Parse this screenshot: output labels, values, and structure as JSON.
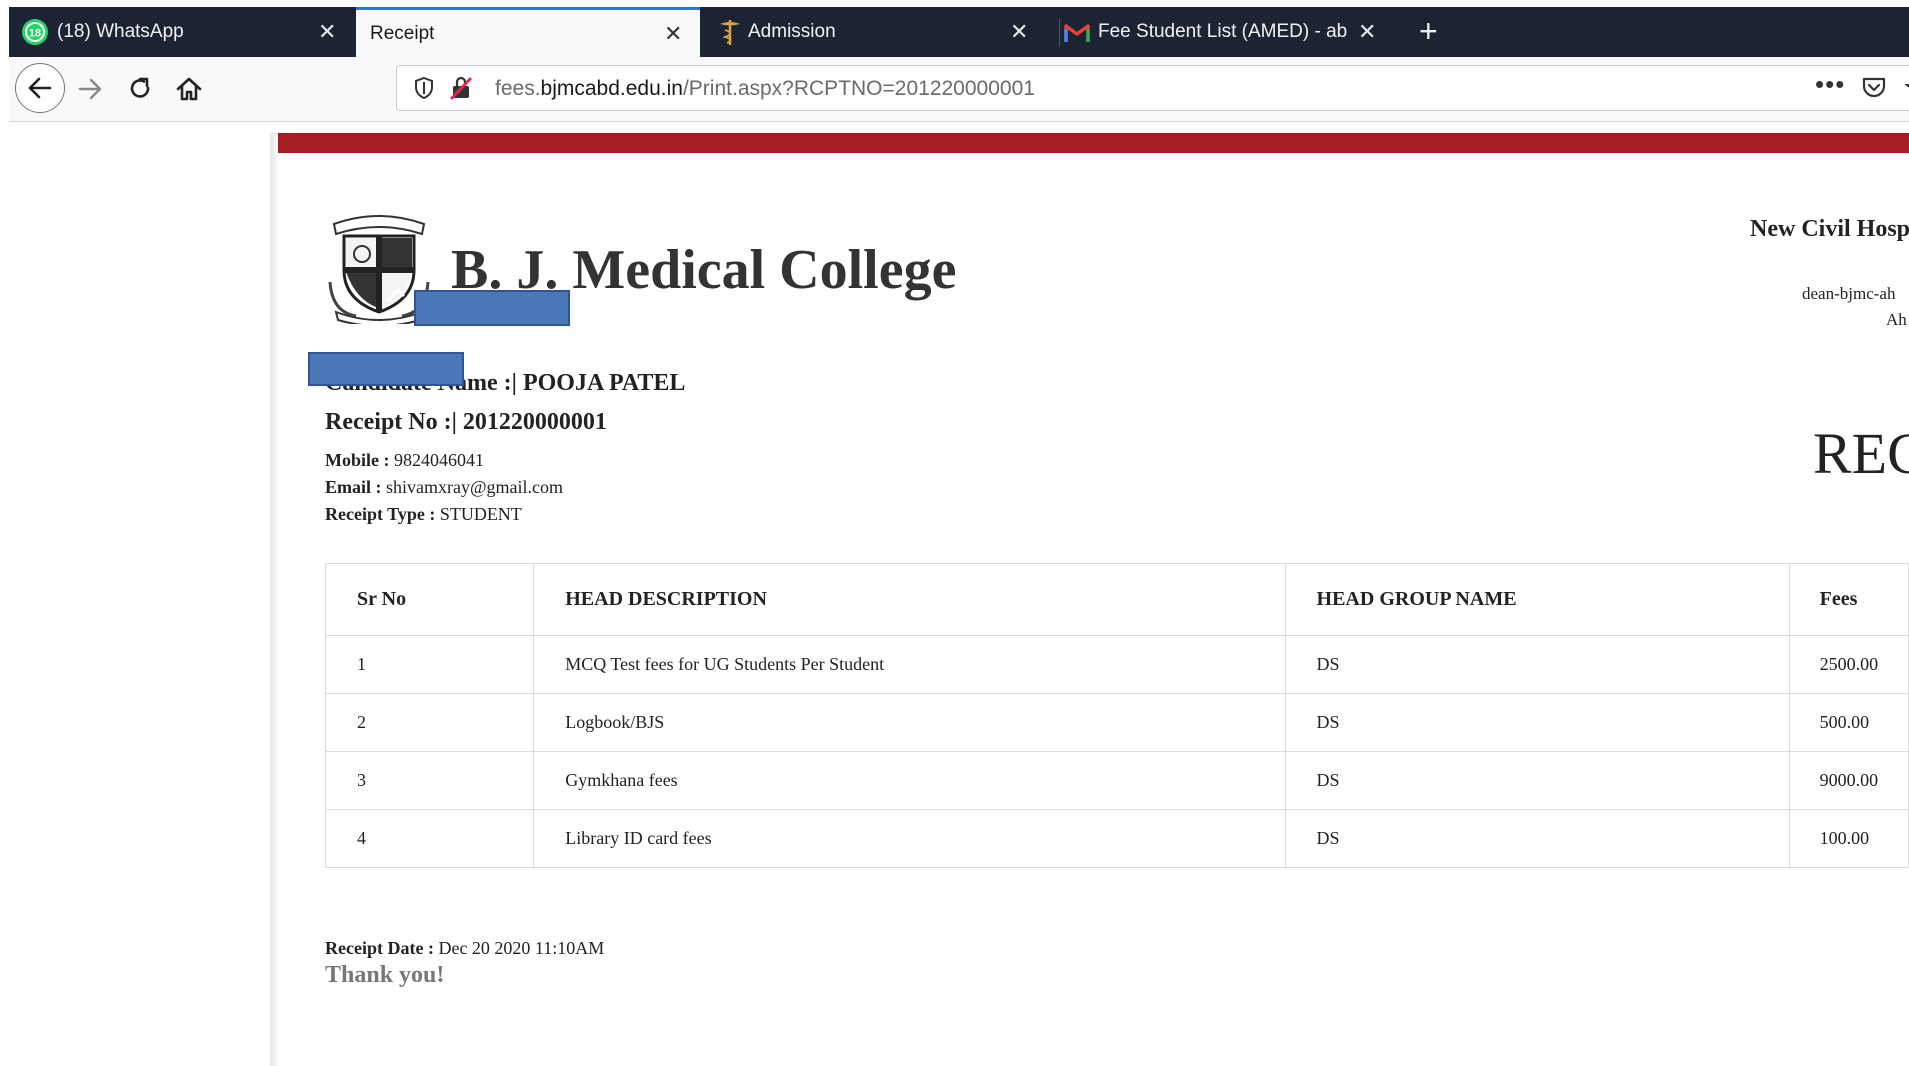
{
  "browser": {
    "tabs": [
      {
        "title": "(18) WhatsApp",
        "icon": "whatsapp-icon",
        "active": false
      },
      {
        "title": "Receipt",
        "icon": "",
        "active": true
      },
      {
        "title": "Admission",
        "icon": "caduceus-icon",
        "active": false
      },
      {
        "title": "Fee Student List (AMED) - abni",
        "icon": "gmail-icon",
        "active": false
      }
    ],
    "whatsapp_badge": "18",
    "url": {
      "prefix": "fees.",
      "domain": "bjmcabd.edu.in",
      "path": "/Print.aspx?RCPTNO=201220000001"
    },
    "colors": {
      "tabbar": "#1c2333",
      "active_tab_accent": "#2a77d4"
    }
  },
  "receipt": {
    "college_name": "B. J. Medical College",
    "hospital_partial": "New Civil Hosp",
    "dean_email_partial": "dean-bjmc-ah",
    "city_partial": "Ah",
    "heading_partial": "REC",
    "candidate_name_label": "Candidate Name :|",
    "candidate_name": "POOJA PATEL",
    "receipt_no_label": "Receipt No :|",
    "receipt_no": "201220000001",
    "mobile_label": "Mobile :",
    "mobile": "9824046041",
    "email_label": "Email :",
    "email": "shivamxray@gmail.com",
    "receipt_type_label": "Receipt Type :",
    "receipt_type": "STUDENT",
    "table": {
      "headers": [
        "Sr No",
        "HEAD DESCRIPTION",
        "HEAD GROUP NAME",
        "Fees"
      ],
      "rows": [
        [
          "1",
          "MCQ Test fees for UG Students Per Student",
          "DS",
          "2500.00"
        ],
        [
          "2",
          "Logbook/BJS",
          "DS",
          "500.00"
        ],
        [
          "3",
          "Gymkhana fees",
          "DS",
          "9000.00"
        ],
        [
          "4",
          "Library ID card fees",
          "DS",
          "100.00"
        ]
      ]
    },
    "receipt_date_label": "Receipt Date :",
    "receipt_date": "Dec 20 2020 11:10AM",
    "thank_you": "Thank you!",
    "colors": {
      "top_bar": "#a51c22",
      "redaction": "#4a78b8"
    }
  }
}
